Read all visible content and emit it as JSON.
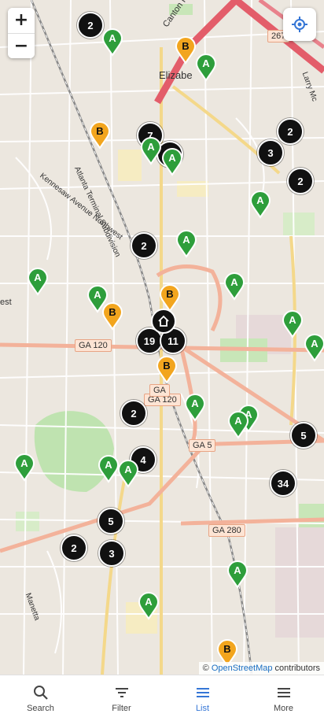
{
  "map": {
    "attribution_prefix": "© ",
    "attribution_link": "OpenStreetMap",
    "attribution_suffix": " contributors",
    "place_label": "Elizabe",
    "road_labels": [
      "Canton Road Connector",
      "Kennesaw Avenue Northwest",
      "Atlanta Terminal Subdivision",
      "Manetta",
      "Larry Mc",
      "est"
    ],
    "route_labels": [
      "GA 120",
      "GA 120",
      "GA 5",
      "GA 280",
      "267",
      "GA"
    ],
    "zoom_in_label": "+",
    "zoom_out_label": "−",
    "locate_icon": "crosshair-icon",
    "colors": {
      "pin_a": "#2e9e3b",
      "pin_b": "#f2a51e",
      "cluster": "#111111",
      "active_tab": "#3576d6"
    }
  },
  "clusters": [
    "2",
    "7",
    "4",
    "2",
    "3",
    "2",
    "2",
    "19",
    "11",
    "2",
    "4",
    "5",
    "34",
    "5",
    "2",
    "3"
  ],
  "pins": [
    "A",
    "B",
    "A",
    "B",
    "A",
    "A",
    "A",
    "A",
    "A",
    "A",
    "A",
    "B",
    "B",
    "A",
    "A",
    "A",
    "B",
    "A",
    "A",
    "A",
    "A",
    "A",
    "A",
    "B",
    "A"
  ],
  "tabs": [
    {
      "label": "Search",
      "icon": "search-icon",
      "active": false
    },
    {
      "label": "Filter",
      "icon": "filter-icon",
      "active": false
    },
    {
      "label": "List",
      "icon": "list-icon",
      "active": true
    },
    {
      "label": "More",
      "icon": "menu-icon",
      "active": false
    }
  ]
}
